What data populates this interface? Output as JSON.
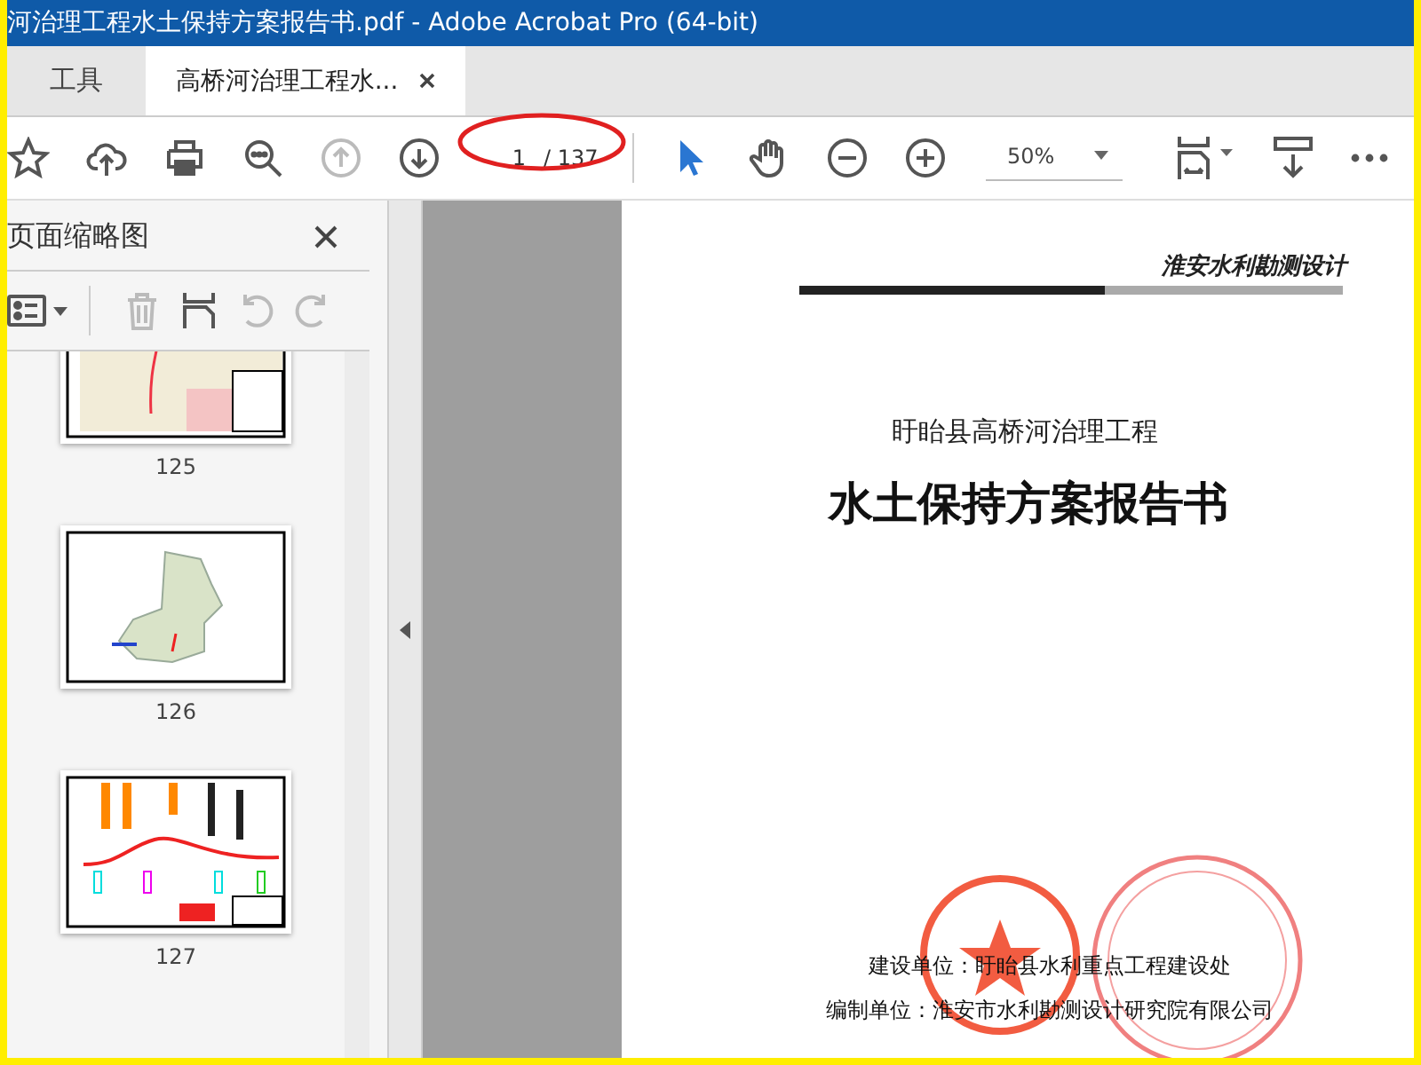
{
  "window": {
    "title": "河治理工程水土保持方案报告书.pdf - Adobe Acrobat Pro (64-bit)"
  },
  "tabs": [
    {
      "label": "工具",
      "kind": "home",
      "selected": false
    },
    {
      "label": "高桥河治理工程水...",
      "kind": "document",
      "selected": true
    }
  ],
  "toolbar": {
    "nav_tools": [
      {
        "kind": "star",
        "disabled": false
      },
      {
        "kind": "upload",
        "disabled": false
      },
      {
        "kind": "print",
        "disabled": false
      },
      {
        "kind": "search",
        "disabled": false
      },
      {
        "kind": "prev",
        "disabled": true
      },
      {
        "kind": "next",
        "disabled": false
      }
    ],
    "page_input": "1",
    "page_total": "/ 137",
    "view_tools": [
      {
        "kind": "select",
        "selected": true
      },
      {
        "kind": "hand",
        "selected": false
      },
      {
        "kind": "zoom-out",
        "selected": false
      },
      {
        "kind": "zoom-in",
        "selected": false
      }
    ],
    "zoom": "50%"
  },
  "thumbnails_panel": {
    "title": "页面缩略图",
    "tools": [
      {
        "kind": "options",
        "disabled": false
      },
      {
        "kind": "delete",
        "disabled": true
      },
      {
        "kind": "insert",
        "disabled": false
      },
      {
        "kind": "rotate-left",
        "disabled": true
      },
      {
        "kind": "rotate-right",
        "disabled": true
      }
    ],
    "pages": [
      {
        "label": "125",
        "kind": "map"
      },
      {
        "label": "126",
        "kind": "county"
      },
      {
        "label": "127",
        "kind": "profile"
      }
    ]
  },
  "document": {
    "logo": "淮安水利勘测设计",
    "subtitle": "盱眙县高桥河治理工程",
    "title": "水土保持方案报告书",
    "lines": [
      "建设单位：盱眙县水利重点工程建设处",
      "编制单位：淮安市水利勘测设计研究院有限公司"
    ]
  }
}
